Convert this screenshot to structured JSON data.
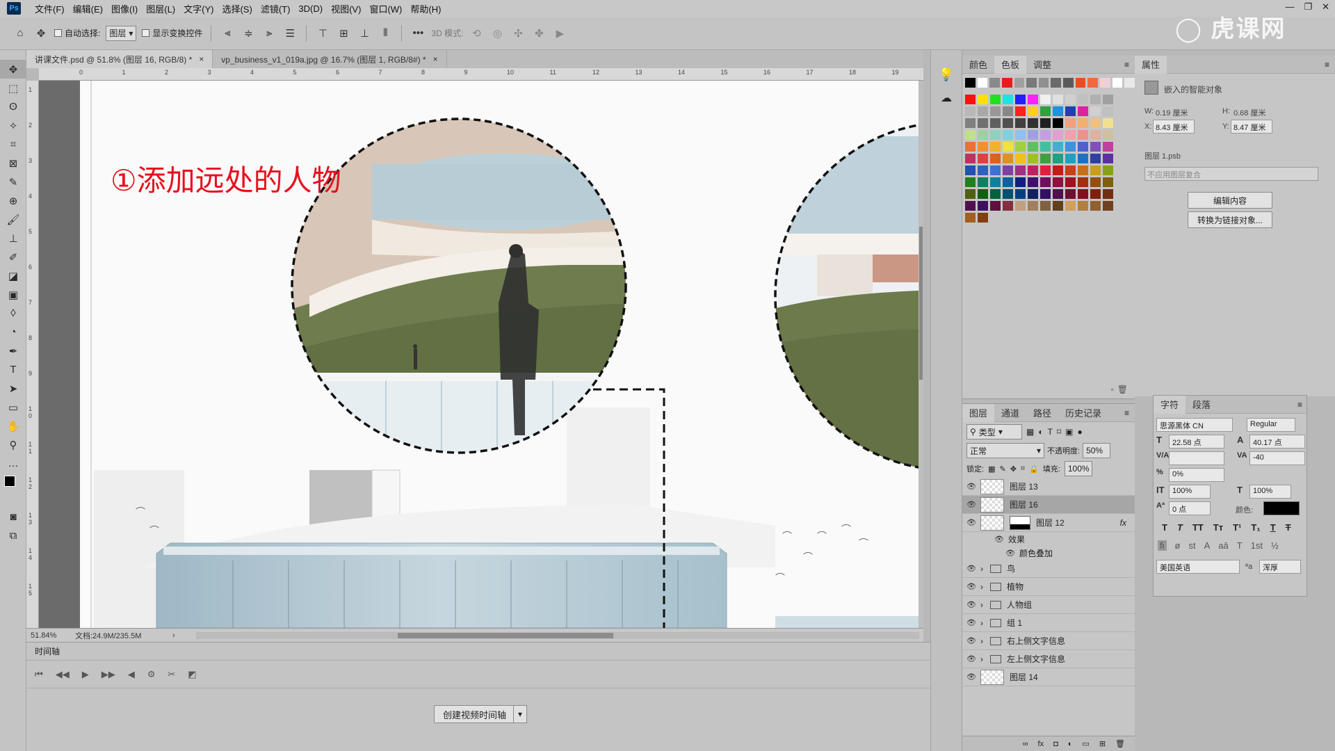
{
  "menubar": {
    "logo": "Ps",
    "items": [
      "文件(F)",
      "编辑(E)",
      "图像(I)",
      "图层(L)",
      "文字(Y)",
      "选择(S)",
      "滤镜(T)",
      "3D(D)",
      "视图(V)",
      "窗口(W)",
      "帮助(H)"
    ],
    "win_controls": [
      "—",
      "❐",
      "✕"
    ]
  },
  "options": {
    "auto_select_label": "自动选择:",
    "auto_select_value": "图层",
    "show_transform_label": "显示变换控件",
    "mode_3d_label": "3D 模式:",
    "more": "•••"
  },
  "tabs": [
    {
      "label": "讲课文件.psd @ 51.8% (图层 16, RGB/8) *",
      "close": "×"
    },
    {
      "label": "vp_business_v1_019a.jpg @ 16.7% (图层 1, RGB/8#) *",
      "close": "×"
    }
  ],
  "ruler": {
    "h": [
      "0",
      "1",
      "2",
      "3",
      "4",
      "5",
      "6",
      "7",
      "8",
      "9",
      "10",
      "11",
      "12",
      "13",
      "14",
      "15",
      "16",
      "17",
      "18",
      "19"
    ],
    "v": [
      "1",
      "2",
      "3",
      "4",
      "5",
      "6",
      "7",
      "8",
      "9",
      "1\n0",
      "1\n1",
      "1\n2",
      "1\n3",
      "1\n4",
      "1\n5"
    ]
  },
  "canvas": {
    "caption": "①添加远处的人物"
  },
  "status": {
    "zoom": "51.84%",
    "doc": "文档:24.9M/235.5M",
    "arrow": "›"
  },
  "timeline": {
    "title": "时间轴",
    "create_button": "创建视频时间轴"
  },
  "swatches": {
    "tabs": [
      "颜色",
      "色板",
      "调整"
    ],
    "rows": [
      [
        "#000000",
        "#ffffff",
        "#8a8a8a",
        "#e81c1c",
        "#a0a0a0",
        "#7a7a7a",
        "#909090",
        "#6a6a6a",
        "#5a5a5a",
        "#f04a20",
        "#f06a40",
        "#f0d0d8",
        "#ffffff",
        "#e8e8e8"
      ],
      [
        "#ff1010",
        "#ffe000",
        "#20e020",
        "#20e0e0",
        "#2020ff",
        "#ff20ff",
        "#f0f0f0",
        "#e0e0e0",
        "#d0d0d0",
        "#c0c0c0",
        "#b0b0b0",
        "#a0a0a0"
      ],
      [
        "#b8b8b8",
        "#a8a8a8",
        "#989898",
        "#888888",
        "#ff2020",
        "#ffd020",
        "#30a040",
        "#2090e0",
        "#2040b0",
        "#e020a0",
        "#d0d0d0",
        "#c0c0c0"
      ],
      [
        "#808080",
        "#707070",
        "#606060",
        "#505050",
        "#404040",
        "#303030",
        "#202020",
        "#000000",
        "#f0a080",
        "#f0b070",
        "#f0c080",
        "#f0e090"
      ],
      [
        "#c0e090",
        "#a0d0a0",
        "#90d0c0",
        "#80d0e0",
        "#90c0f0",
        "#a0a0e0",
        "#c0a0e0",
        "#e0a0d0",
        "#f0a0b0",
        "#f09090",
        "#e0b0a0",
        "#d0c0a0"
      ],
      [
        "#f07030",
        "#f09030",
        "#f0b030",
        "#f0e040",
        "#a0d040",
        "#60c060",
        "#40c0a0",
        "#40b0d0",
        "#4090e0",
        "#5060d0",
        "#8050c0",
        "#c040a0"
      ],
      [
        "#c03060",
        "#e04040",
        "#e06020",
        "#e09020",
        "#f0c020",
        "#a0c020",
        "#40a040",
        "#20a080",
        "#20a0c0",
        "#2070c0",
        "#3040a0",
        "#6030a0"
      ],
      [
        "#2050b0",
        "#3060c0",
        "#4070d0",
        "#8040a0",
        "#a03080",
        "#c02060",
        "#e02040",
        "#c81818",
        "#c84018",
        "#c87018",
        "#c8a018",
        "#88a018"
      ],
      [
        "#208020",
        "#108060",
        "#1080a0",
        "#1060a0",
        "#102080",
        "#401070",
        "#701060",
        "#901040",
        "#a01020",
        "#a03010",
        "#905010",
        "#806010"
      ],
      [
        "#506010",
        "#106010",
        "#006040",
        "#005070",
        "#004080",
        "#102060",
        "#301060",
        "#501050",
        "#701030",
        "#801020",
        "#802010",
        "#703010"
      ],
      [
        "#501050",
        "#401060",
        "#601040",
        "#803040",
        "#c0a080",
        "#a08060",
        "#806040",
        "#604020",
        "#d0a060",
        "#b08040",
        "#906030",
        "#704020"
      ],
      [
        "#a06020",
        "#804010"
      ]
    ]
  },
  "layers": {
    "tabs": [
      "图层",
      "通道",
      "路径",
      "历史记录"
    ],
    "filter": "类型",
    "blend": "正常",
    "opacity_label": "不透明度:",
    "opacity": "50%",
    "lock_label": "锁定:",
    "fill_label": "填充:",
    "fill": "100%",
    "items": [
      {
        "name": "图层 13",
        "kind": "layer"
      },
      {
        "name": "图层 16",
        "kind": "smart",
        "selected": true
      },
      {
        "name": "图层 12",
        "kind": "mask",
        "fx": "fx"
      },
      {
        "name": "效果",
        "kind": "effect"
      },
      {
        "name": "颜色叠加",
        "kind": "effect-sub"
      },
      {
        "name": "鸟",
        "kind": "group"
      },
      {
        "name": "植物",
        "kind": "group"
      },
      {
        "name": "人物组",
        "kind": "group"
      },
      {
        "name": "组 1",
        "kind": "group"
      },
      {
        "name": "右上侧文字信息",
        "kind": "group"
      },
      {
        "name": "左上侧文字信息",
        "kind": "group"
      },
      {
        "name": "图层 14",
        "kind": "layer"
      }
    ],
    "footer": [
      "∞",
      "fx",
      "◘",
      "◐",
      "▭",
      "⊞",
      "🗑"
    ]
  },
  "properties": {
    "title": "属性",
    "type": "嵌入的智能对象",
    "w_label": "W:",
    "w": "0.19 厘米",
    "h_label": "H:",
    "h": "0.68 厘米",
    "x_label": "X:",
    "x": "8.43 厘米",
    "y_label": "Y:",
    "y": "8.47 厘米",
    "file_label": "图层 1.psb",
    "comp": "不应用图层复合",
    "edit_btn": "编辑内容",
    "convert_btn": "转换为链接对象..."
  },
  "character": {
    "tabs": [
      "字符",
      "段落"
    ],
    "font": "思源黑体 CN",
    "style": "Regular",
    "size": "22.58 点",
    "leading": "40.17 点",
    "kerning": "",
    "tracking": "-40",
    "scale_pct": "0%",
    "vscale": "100%",
    "hscale": "100%",
    "baseline": "0 点",
    "color_label": "颜色:",
    "language": "美国英语",
    "aa_label": "ªa",
    "aa": "浑厚"
  }
}
